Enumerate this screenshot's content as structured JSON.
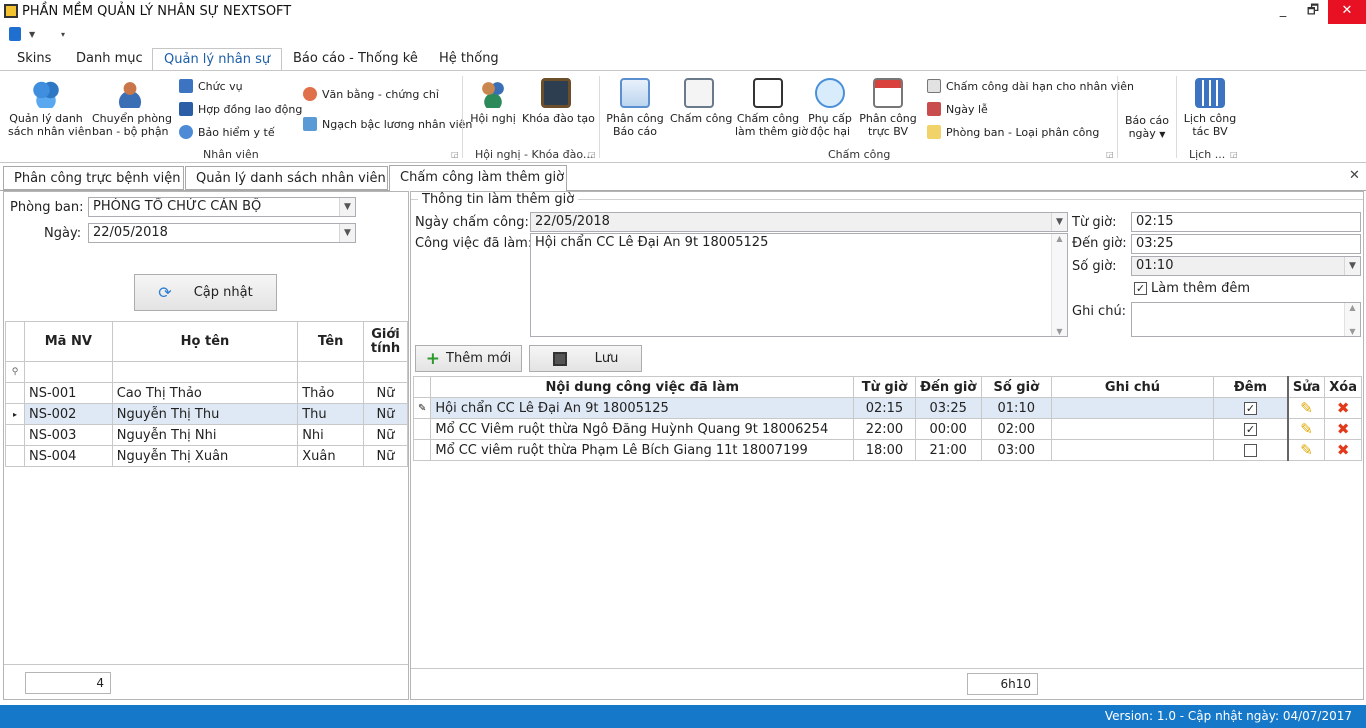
{
  "app": {
    "title": "PHẦN MỀM QUẢN LÝ NHÂN SỰ NEXTSOFT",
    "win_min": "_",
    "win_max": "🗗",
    "win_close": "✕"
  },
  "menu_tabs": [
    "Skins",
    "Danh mục",
    "Quản lý nhân sự",
    "Báo cáo - Thống kê",
    "Hệ thống"
  ],
  "ribbon": {
    "nhanvien": {
      "btn1": "Quản lý danh",
      "btn1b": "sách nhân viên",
      "btn2": "Chuyển phòng",
      "btn2b": "ban - bộ phận",
      "s1": "Chức vụ",
      "s2": "Hợp đồng lao động",
      "s3": "Bảo hiểm y tế",
      "s4": "Văn bằng - chứng chỉ",
      "s5": "Ngạch bậc lương nhân viên",
      "group": "Nhân viên"
    },
    "hoinghi": {
      "btn1": "Hội nghị",
      "btn2": "Khóa đào tạo",
      "group": "Hội nghị - Khóa đào..."
    },
    "chamcong": {
      "btn1": "Phân công",
      "btn1b": "Báo cáo",
      "btn2": "Chấm công",
      "btn3": "Chấm công",
      "btn3b": "làm thêm giờ",
      "btn4": "Phụ cấp",
      "btn4b": "độc hại",
      "btn5": "Phân công",
      "btn5b": "trực BV",
      "s1": "Chấm công dài hạn cho nhân viên",
      "s2": "Ngày lễ",
      "s3": "Phòng ban - Loại phân công",
      "group": "Chấm công"
    },
    "baocao": {
      "btn1": "Báo cáo",
      "btn1b": "ngày"
    },
    "lich": {
      "btn1": "Lịch công",
      "btn1b": "tác BV",
      "group": "Lịch ..."
    }
  },
  "doc_tabs": [
    "Phân công trực bệnh viện",
    "Quản lý danh sách nhân viên",
    "Chấm công làm thêm giờ"
  ],
  "left": {
    "phongban_label": "Phòng ban:",
    "phongban_value": "PHÒNG TỔ CHỨC CÁN BỘ",
    "ngay_label": "Ngày:",
    "ngay_value": "22/05/2018",
    "update_btn": "Cập nhật",
    "headers": [
      "Mã NV",
      "Họ tên",
      "Tên",
      "Giới tính"
    ],
    "rows": [
      [
        "NS-001",
        "Cao Thị Thảo",
        "Thảo",
        "Nữ"
      ],
      [
        "NS-002",
        "Nguyễn Thị Thu",
        "Thu",
        "Nữ"
      ],
      [
        "NS-003",
        "Nguyễn Thị Nhi",
        "Nhi",
        "Nữ"
      ],
      [
        "NS-004",
        "Nguyễn Thị Xuân",
        "Xuân",
        "Nữ"
      ]
    ],
    "count": "4"
  },
  "right": {
    "group_title": "Thông tin làm thêm giờ",
    "ngay_label": "Ngày chấm công:",
    "ngay_value": "22/05/2018",
    "congviec_label": "Công việc đã làm:",
    "congviec_value": "Hội chẩn CC Lê Đại An 9t 18005125",
    "tugio_label": "Từ giờ:",
    "tugio_value": "02:15",
    "dengio_label": "Đến giờ:",
    "dengio_value": "03:25",
    "sogio_label": "Số giờ:",
    "sogio_value": "01:10",
    "lamdem_label": "Làm thêm đêm",
    "lamdem_checked": true,
    "ghichu_label": "Ghi chú:",
    "ghichu_value": "",
    "add_btn": "Thêm mới",
    "save_btn": "Lưu",
    "headers": [
      "Nội dung công việc đã làm",
      "Từ giờ",
      "Đến giờ",
      "Số giờ",
      "Ghi chú",
      "Đêm",
      "Sửa",
      "Xóa"
    ],
    "rows": [
      {
        "noidung": "Hội chẩn CC Lê Đại An 9t 18005125",
        "tu": "02:15",
        "den": "03:25",
        "so": "01:10",
        "ghichu": "",
        "dem": true
      },
      {
        "noidung": "Mổ CC Viêm ruột thừa Ngô Đăng Huỳnh Quang 9t 18006254",
        "tu": "22:00",
        "den": "00:00",
        "so": "02:00",
        "ghichu": "",
        "dem": true
      },
      {
        "noidung": "Mổ CC viêm ruột thừa Phạm Lê Bích Giang 11t 18007199",
        "tu": "18:00",
        "den": "21:00",
        "so": "03:00",
        "ghichu": "",
        "dem": false
      }
    ],
    "total": "6h10"
  },
  "status": {
    "text": "Version: 1.0 - Cập nhật ngày: 04/07/2017"
  }
}
